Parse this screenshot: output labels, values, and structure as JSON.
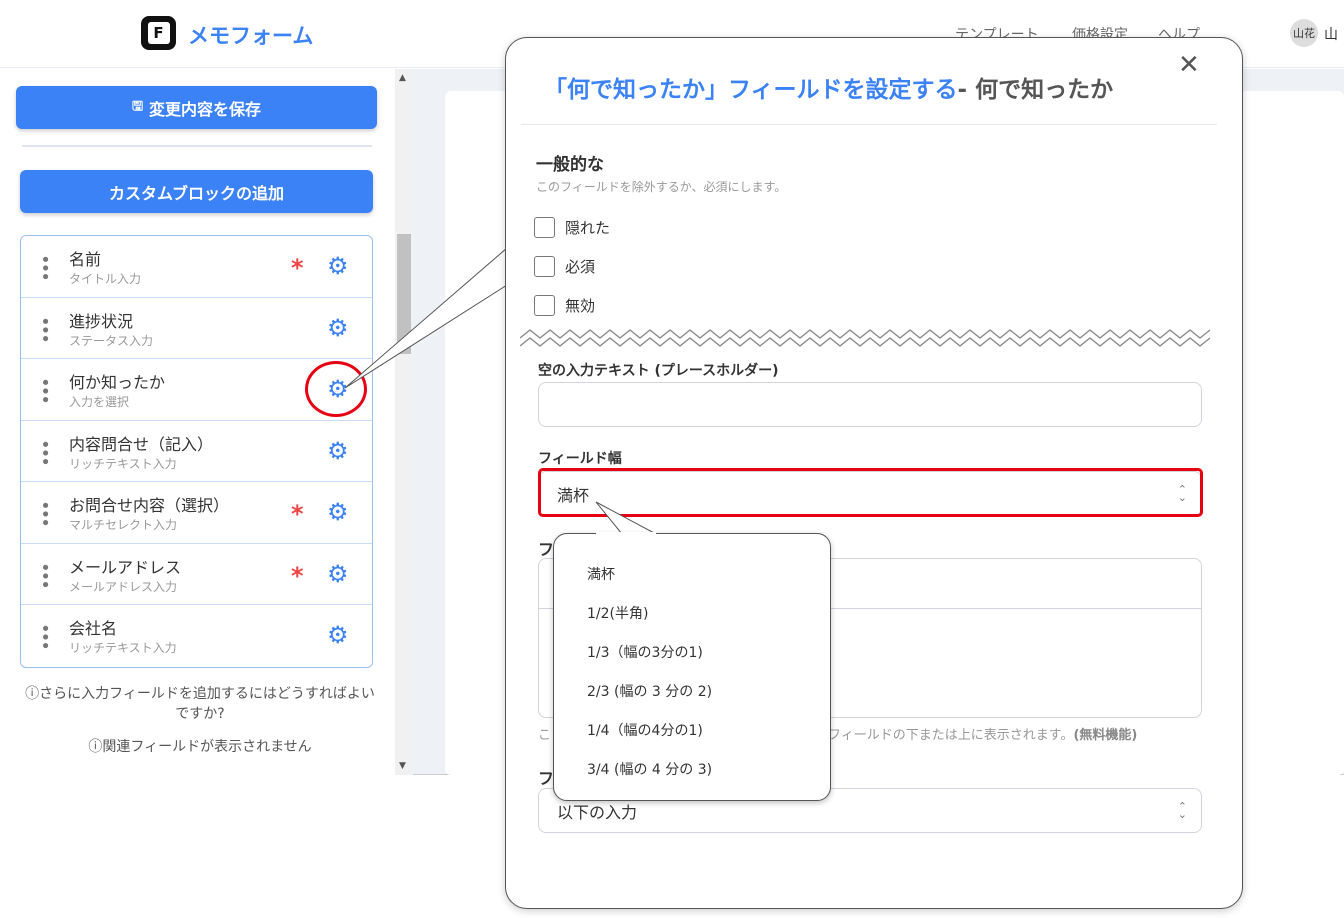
{
  "header": {
    "logo_letter": "F",
    "brand": "メモフォーム",
    "nav": [
      "テンプレート",
      "価格設定",
      "ヘルプ"
    ],
    "avatar": "山花",
    "user": "山"
  },
  "sidebar": {
    "save_label": "変更内容を保存",
    "add_block_label": "カスタムブロックの追加",
    "items": [
      {
        "name": "名前",
        "type": "タイトル入力",
        "required": true
      },
      {
        "name": "進捗状況",
        "type": "ステータス入力",
        "required": false
      },
      {
        "name": "何か知ったか",
        "type": "入力を選択",
        "required": false
      },
      {
        "name": "内容問合せ（記入）",
        "type": "リッチテキスト入力",
        "required": false
      },
      {
        "name": "お問合せ内容（選択）",
        "type": "マルチセレクト入力",
        "required": true
      },
      {
        "name": "メールアドレス",
        "type": "メールアドレス入力",
        "required": true
      },
      {
        "name": "会社名",
        "type": "リッチテキスト入力",
        "required": false
      }
    ],
    "hint1": "さらに入力フィールドを追加するにはどうすればよいですか?",
    "hint2": "関連フィールドが表示されません"
  },
  "modal": {
    "title_blue": "「何で知ったか」フィールドを設定する",
    "title_gray": "- 何で知ったか",
    "general_heading": "一般的な",
    "general_sub": "このフィールドを除外するか、必須にします。",
    "checkboxes": [
      "隠れた",
      "必須",
      "無効"
    ],
    "placeholder_label": "空の入力テキスト (プレースホルダー)",
    "placeholder_value": "",
    "width_label": "フィールド幅",
    "width_value": "満杯",
    "label3_fragment": "フ",
    "label4_fragment": "フ",
    "help_prefix": "こ",
    "help_text": "がフィールドの下または上に表示されます。",
    "help_bold": "(無料機能)",
    "bottom_select_value": "以下の入力"
  },
  "dropdown": {
    "options": [
      "満杯",
      "1/2(半角)",
      "1/3（幅の3分の1)",
      "2/3 (幅の 3 分の 2)",
      "1/4（幅の4分の1)",
      "3/4 (幅の 4 分の 3)"
    ]
  },
  "colors": {
    "accent": "#3b82f6",
    "highlight": "#e60012",
    "required": "#ef4444"
  }
}
